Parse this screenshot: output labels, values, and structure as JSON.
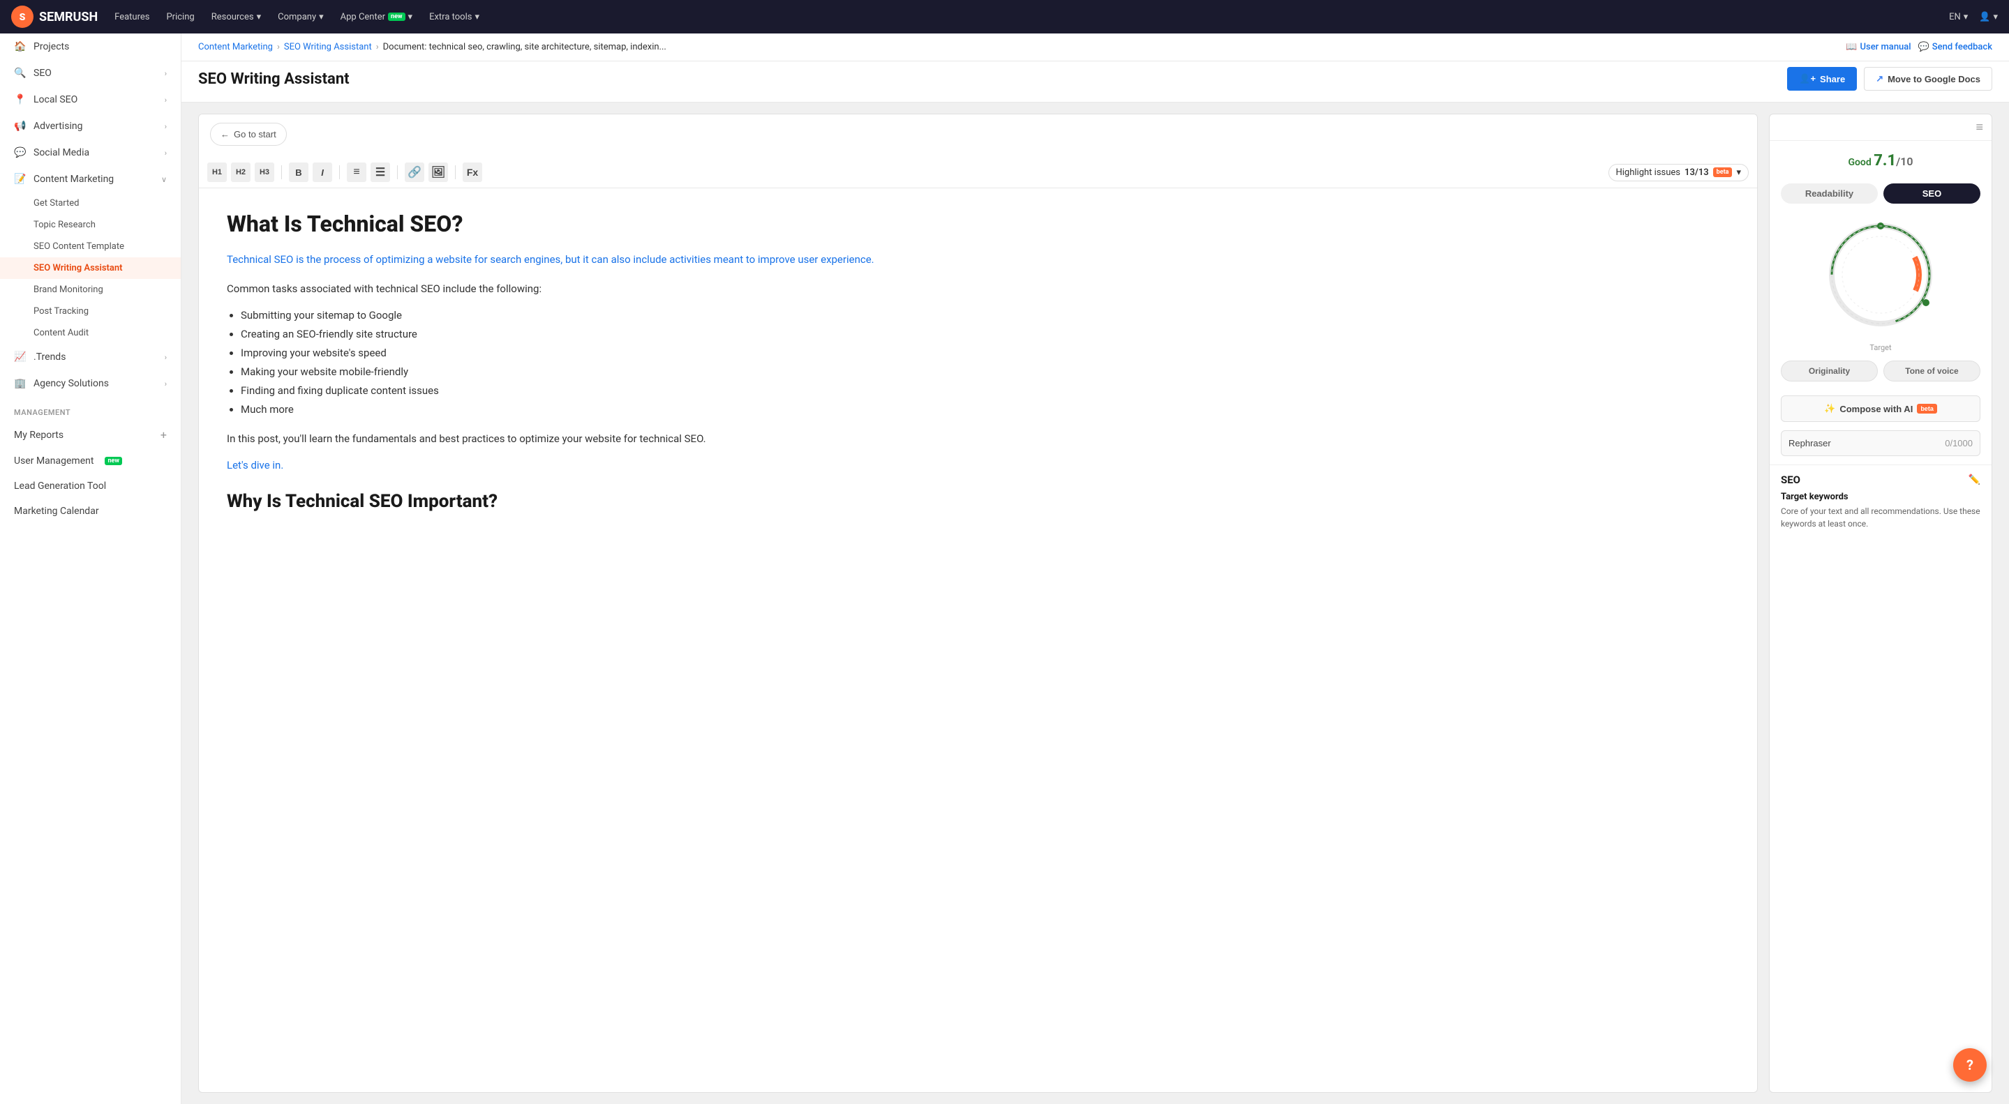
{
  "nav": {
    "logo_text": "SEMRUSH",
    "items": [
      {
        "label": "Features"
      },
      {
        "label": "Pricing"
      },
      {
        "label": "Resources",
        "has_arrow": true
      },
      {
        "label": "Company",
        "has_arrow": true
      },
      {
        "label": "App Center",
        "badge": "new",
        "has_arrow": true
      },
      {
        "label": "Extra tools",
        "has_arrow": true
      }
    ],
    "lang": "EN",
    "user_icon": "👤"
  },
  "sidebar": {
    "items": [
      {
        "label": "Projects",
        "icon": "🏠",
        "type": "main"
      },
      {
        "label": "SEO",
        "icon": "🔍",
        "type": "main",
        "has_chevron": true
      },
      {
        "label": "Local SEO",
        "icon": "📍",
        "type": "main",
        "has_chevron": true
      },
      {
        "label": "Advertising",
        "icon": "📢",
        "type": "main",
        "has_chevron": true
      },
      {
        "label": "Social Media",
        "icon": "💬",
        "type": "main",
        "has_chevron": true
      },
      {
        "label": "Content Marketing",
        "icon": "📝",
        "type": "main",
        "has_chevron": true,
        "expanded": true
      }
    ],
    "content_marketing_sub": [
      {
        "label": "Get Started"
      },
      {
        "label": "Topic Research"
      },
      {
        "label": "SEO Content Template"
      },
      {
        "label": "SEO Writing Assistant",
        "active": true
      },
      {
        "label": "Brand Monitoring"
      },
      {
        "label": "Post Tracking"
      },
      {
        "label": "Content Audit"
      }
    ],
    "bottom_items": [
      {
        "label": ".Trends",
        "icon": "📈",
        "has_chevron": true
      },
      {
        "label": "Agency Solutions",
        "icon": "🏢",
        "has_chevron": true
      }
    ],
    "management_label": "MANAGEMENT",
    "management_items": [
      {
        "label": "My Reports",
        "has_plus": true
      },
      {
        "label": "User Management",
        "badge": "new"
      },
      {
        "label": "Lead Generation Tool"
      },
      {
        "label": "Marketing Calendar"
      }
    ]
  },
  "breadcrumb": {
    "items": [
      "Content Marketing",
      "SEO Writing Assistant",
      "Document: technical seo, crawling, site architecture, sitemap, indexin..."
    ]
  },
  "header": {
    "title": "SEO Writing Assistant",
    "user_manual": "User manual",
    "send_feedback": "Send feedback",
    "share_btn": "Share",
    "move_btn": "Move to Google Docs"
  },
  "editor": {
    "go_start": "Go to start",
    "highlight_issues": "Highlight issues",
    "highlight_count": "13/13",
    "h1": "What Is Technical SEO?",
    "lead": "Technical SEO is the process of optimizing a website for search engines, but it can also include activities meant to improve user experience.",
    "p1": "Common tasks associated with technical SEO include the following:",
    "bullets": [
      "Submitting your sitemap to Google",
      "Creating an SEO-friendly site structure",
      "Improving your website's speed",
      "Making your website mobile-friendly",
      "Finding and fixing duplicate content issues",
      "Much more"
    ],
    "p2": "In this post, you'll learn the fundamentals and best practices to optimize your website for technical SEO.",
    "link_text": "Let's dive in.",
    "h2": "Why Is Technical SEO Important?"
  },
  "right_panel": {
    "score_label": "Good",
    "score_value": "7.1",
    "score_denom": "/10",
    "tab_readability": "Readability",
    "tab_seo": "SEO",
    "gauge_target_label": "Target",
    "metric_originality": "Originality",
    "metric_tone_of_voice": "Tone of voice",
    "compose_label": "Compose with AI",
    "compose_badge": "beta",
    "rephraser_label": "Rephraser",
    "rephraser_count": "0/1000",
    "seo_title": "SEO",
    "target_keywords_title": "Target keywords",
    "target_keywords_desc": "Core of your text and all recommendations. Use these keywords at least once."
  },
  "fab": "?"
}
